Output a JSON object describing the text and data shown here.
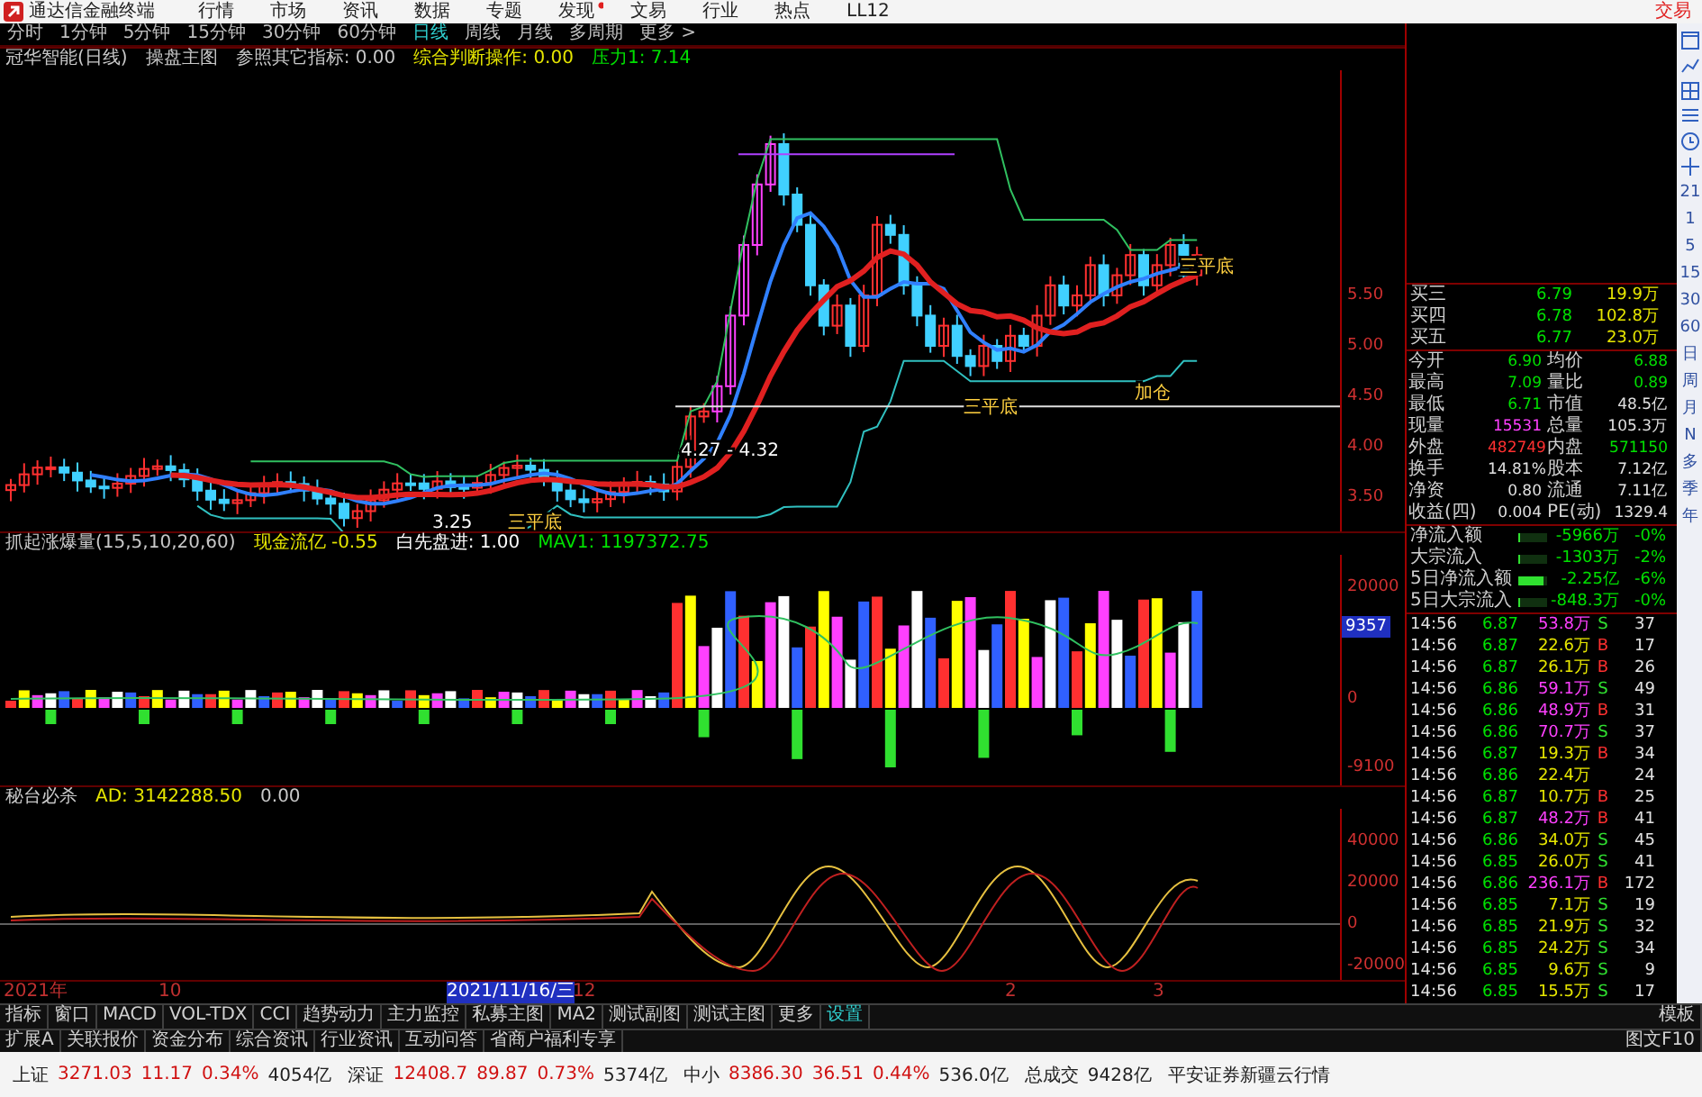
{
  "app_bar": {
    "title": "通达信金融终端",
    "menu": [
      {
        "label": "行情",
        "badge": false
      },
      {
        "label": "市场",
        "badge": false
      },
      {
        "label": "资讯",
        "badge": false
      },
      {
        "label": "数据",
        "badge": false
      },
      {
        "label": "专题",
        "badge": false
      },
      {
        "label": "发现",
        "badge": true
      },
      {
        "label": "文易",
        "badge": false
      },
      {
        "label": "行业",
        "badge": false
      },
      {
        "label": "热点",
        "badge": false
      },
      {
        "label": "LL12",
        "badge": false
      }
    ],
    "trade": "交易"
  },
  "period_tabs": [
    {
      "label": "分时",
      "selected": false
    },
    {
      "label": "1分钟",
      "selected": false
    },
    {
      "label": "5分钟",
      "selected": false
    },
    {
      "label": "15分钟",
      "selected": false
    },
    {
      "label": "30分钟",
      "selected": false
    },
    {
      "label": "60分钟",
      "selected": false
    },
    {
      "label": "日线",
      "selected": true
    },
    {
      "label": "周线",
      "selected": false
    },
    {
      "label": "月线",
      "selected": false
    },
    {
      "label": "多周期",
      "selected": false
    },
    {
      "label": "更多 >",
      "selected": false
    }
  ],
  "price_panel": {
    "legend": [
      {
        "text": "冠华智能(日线)",
        "color": "#c8c8c8"
      },
      {
        "text": "操盘主图",
        "color": "#c8c8c8"
      },
      {
        "text": "参照其它指标: 0.00",
        "color": "#c8c8c8"
      },
      {
        "text": "综合判断操作: 0.00",
        "color": "#e6e600"
      },
      {
        "text": "压力1: 7.14",
        "color": "#00e000"
      }
    ],
    "annotations": [
      "三平底",
      "三平底",
      "三平底",
      "加仓",
      "4.27 - 4.32",
      "3.25"
    ],
    "axis": [
      "5.50",
      "5.00",
      "4.50",
      "4.00",
      "3.50"
    ]
  },
  "volume_panel": {
    "legend": [
      {
        "text": "抓起涨爆量(15,5,10,20,60)",
        "color": "#c8c8c8"
      },
      {
        "text": "现金流亿 -0.55",
        "color": "#e6e600"
      },
      {
        "text": "白先盘进: 1.00",
        "color": "#ffffff"
      },
      {
        "text": "MAV1: 1197372.75",
        "color": "#00e000"
      }
    ],
    "axis": [
      {
        "text": "20000",
        "highlighted": false
      },
      {
        "text": "9357",
        "highlighted": true
      },
      {
        "text": "0",
        "highlighted": false
      },
      {
        "text": "-9100",
        "highlighted": false
      }
    ]
  },
  "ad_panel": {
    "legend": [
      {
        "text": "秘台必杀",
        "color": "#c8c8c8"
      },
      {
        "text": "AD: 3142288.50",
        "color": "#e6e600"
      },
      {
        "text": "0.00",
        "color": "#c8c8c8"
      }
    ],
    "axis": [
      "40000",
      "20000",
      "0",
      "-20000"
    ]
  },
  "date_axis": [
    {
      "label": "2021年",
      "selected": false
    },
    {
      "label": "10",
      "selected": false
    },
    {
      "label": "2021/11/16/三",
      "selected": true
    },
    {
      "label": "12",
      "selected": false
    },
    {
      "label": "2",
      "selected": false
    },
    {
      "label": "3",
      "selected": false
    }
  ],
  "bottom_tabs": [
    {
      "label": "指标",
      "selected": false
    },
    {
      "label": "窗口",
      "selected": false
    },
    {
      "label": "MACD",
      "selected": false
    },
    {
      "label": "VOL-TDX",
      "selected": false
    },
    {
      "label": "CCI",
      "selected": false
    },
    {
      "label": "趋势动力",
      "selected": false
    },
    {
      "label": "主力监控",
      "selected": false
    },
    {
      "label": "私募主图",
      "selected": false
    },
    {
      "label": "MA2",
      "selected": false
    },
    {
      "label": "测试副图",
      "selected": false
    },
    {
      "label": "测试主图",
      "selected": false
    },
    {
      "label": "更多",
      "selected": false
    },
    {
      "label": "设置",
      "selected": true
    }
  ],
  "template_button": "模板",
  "extra_tabs": [
    "扩展A",
    "关联报价",
    "资金分布",
    "综合资讯",
    "行业资讯",
    "互动问答",
    "省商户福利专享"
  ],
  "f10_button": "图文F10",
  "quote": {
    "order_book": [
      {
        "label": "买三",
        "price": "6.79",
        "volume": "19.9万"
      },
      {
        "label": "买四",
        "price": "6.78",
        "volume": "102.8万"
      },
      {
        "label": "买五",
        "price": "6.77",
        "volume": "23.0万"
      }
    ],
    "stats": [
      {
        "label": "今开",
        "value": "6.90",
        "color": "#00e000"
      },
      {
        "label": "均价",
        "value": "6.88",
        "color": "#00e000"
      },
      {
        "label": "最高",
        "value": "7.09",
        "color": "#00e000"
      },
      {
        "label": "量比",
        "value": "0.89",
        "color": "#00e000"
      },
      {
        "label": "最低",
        "value": "6.71",
        "color": "#00e000"
      },
      {
        "label": "市值",
        "value": "48.5亿",
        "color": "#e0e0e0"
      },
      {
        "label": "现量",
        "value": "15531",
        "color": "#ff40ff"
      },
      {
        "label": "总量",
        "value": "105.3万",
        "color": "#e0e0e0"
      },
      {
        "label": "外盘",
        "value": "482749",
        "color": "#ff3030"
      },
      {
        "label": "内盘",
        "value": "571150",
        "color": "#00e000"
      },
      {
        "label": "换手",
        "value": "14.81%",
        "color": "#e0e0e0"
      },
      {
        "label": "股本",
        "value": "7.12亿",
        "color": "#e0e0e0"
      },
      {
        "label": "净资",
        "value": "0.80",
        "color": "#e0e0e0"
      },
      {
        "label": "流通",
        "value": "7.11亿",
        "color": "#e0e0e0"
      },
      {
        "label": "收益(四)",
        "value": "0.004",
        "color": "#e0e0e0"
      },
      {
        "label": "PE(动)",
        "value": "1329.4",
        "color": "#e0e0e0"
      }
    ],
    "flows": [
      {
        "label": "净流入额",
        "amount": "-5966万",
        "share": "-0%",
        "level": 0.08
      },
      {
        "label": "大宗流入",
        "amount": "-1303万",
        "share": "-2%",
        "level": 0.02
      },
      {
        "label": "5日净流入额",
        "amount": "-2.25亿",
        "share": "-6%",
        "level": 0.9
      },
      {
        "label": "5日大宗流入",
        "amount": "-848.3万",
        "share": "-0%",
        "level": 0.02
      }
    ],
    "ticks": [
      {
        "time": "14:56",
        "price": "6.87",
        "volume": "53.8万",
        "side": "S",
        "count": "37",
        "large": true
      },
      {
        "time": "14:56",
        "price": "6.87",
        "volume": "22.6万",
        "side": "B",
        "count": "17",
        "large": false
      },
      {
        "time": "14:56",
        "price": "6.87",
        "volume": "26.1万",
        "side": "B",
        "count": "26",
        "large": false
      },
      {
        "time": "14:56",
        "price": "6.86",
        "volume": "59.1万",
        "side": "S",
        "count": "49",
        "large": true
      },
      {
        "time": "14:56",
        "price": "6.86",
        "volume": "48.9万",
        "side": "B",
        "count": "31",
        "large": true
      },
      {
        "time": "14:56",
        "price": "6.86",
        "volume": "70.7万",
        "side": "S",
        "count": "37",
        "large": true
      },
      {
        "time": "14:56",
        "price": "6.87",
        "volume": "19.3万",
        "side": "B",
        "count": "34",
        "large": false
      },
      {
        "time": "14:56",
        "price": "6.86",
        "volume": "22.4万",
        "count": "24",
        "large": false
      },
      {
        "time": "14:56",
        "price": "6.87",
        "volume": "10.7万",
        "side": "B",
        "count": "25",
        "large": false
      },
      {
        "time": "14:56",
        "price": "6.87",
        "volume": "48.2万",
        "side": "B",
        "count": "41",
        "large": true
      },
      {
        "time": "14:56",
        "price": "6.86",
        "volume": "34.0万",
        "side": "S",
        "count": "45",
        "large": false
      },
      {
        "time": "14:56",
        "price": "6.85",
        "volume": "26.0万",
        "side": "S",
        "count": "41",
        "large": false
      },
      {
        "time": "14:56",
        "price": "6.86",
        "volume": "236.1万",
        "side": "B",
        "count": "172",
        "large": true
      },
      {
        "time": "14:56",
        "price": "6.85",
        "volume": "7.1万",
        "side": "S",
        "count": "19",
        "large": false
      },
      {
        "time": "14:56",
        "price": "6.85",
        "volume": "21.9万",
        "side": "S",
        "count": "32",
        "large": false
      },
      {
        "time": "14:56",
        "price": "6.85",
        "volume": "24.2万",
        "side": "S",
        "count": "34",
        "large": false
      },
      {
        "time": "14:56",
        "price": "6.85",
        "volume": "9.6万",
        "side": "S",
        "count": "9",
        "large": false
      },
      {
        "time": "14:56",
        "price": "6.85",
        "volume": "15.5万",
        "side": "S",
        "count": "17",
        "large": false
      }
    ]
  },
  "toolbar": [
    "21",
    "1",
    "5",
    "15",
    "30",
    "60",
    "日",
    "周",
    "月",
    "N",
    "多",
    "季",
    "年"
  ],
  "status_bar": {
    "markets": [
      {
        "name": "上证",
        "value": "3271.03",
        "change": "11.17",
        "percent": "0.34%",
        "turnover": "4054亿",
        "color": "#d01010"
      },
      {
        "name": "深证",
        "value": "12408.7",
        "change": "89.87",
        "percent": "0.73%",
        "turnover": "5374亿",
        "color": "#d01010"
      },
      {
        "name": "中小",
        "value": "8386.30",
        "change": "36.51",
        "percent": "0.44%",
        "turnover": "536.0亿",
        "color": "#d01010"
      }
    ],
    "total_label": "总成交",
    "total": "9428亿",
    "broker": "平安证券新疆云行情"
  }
}
